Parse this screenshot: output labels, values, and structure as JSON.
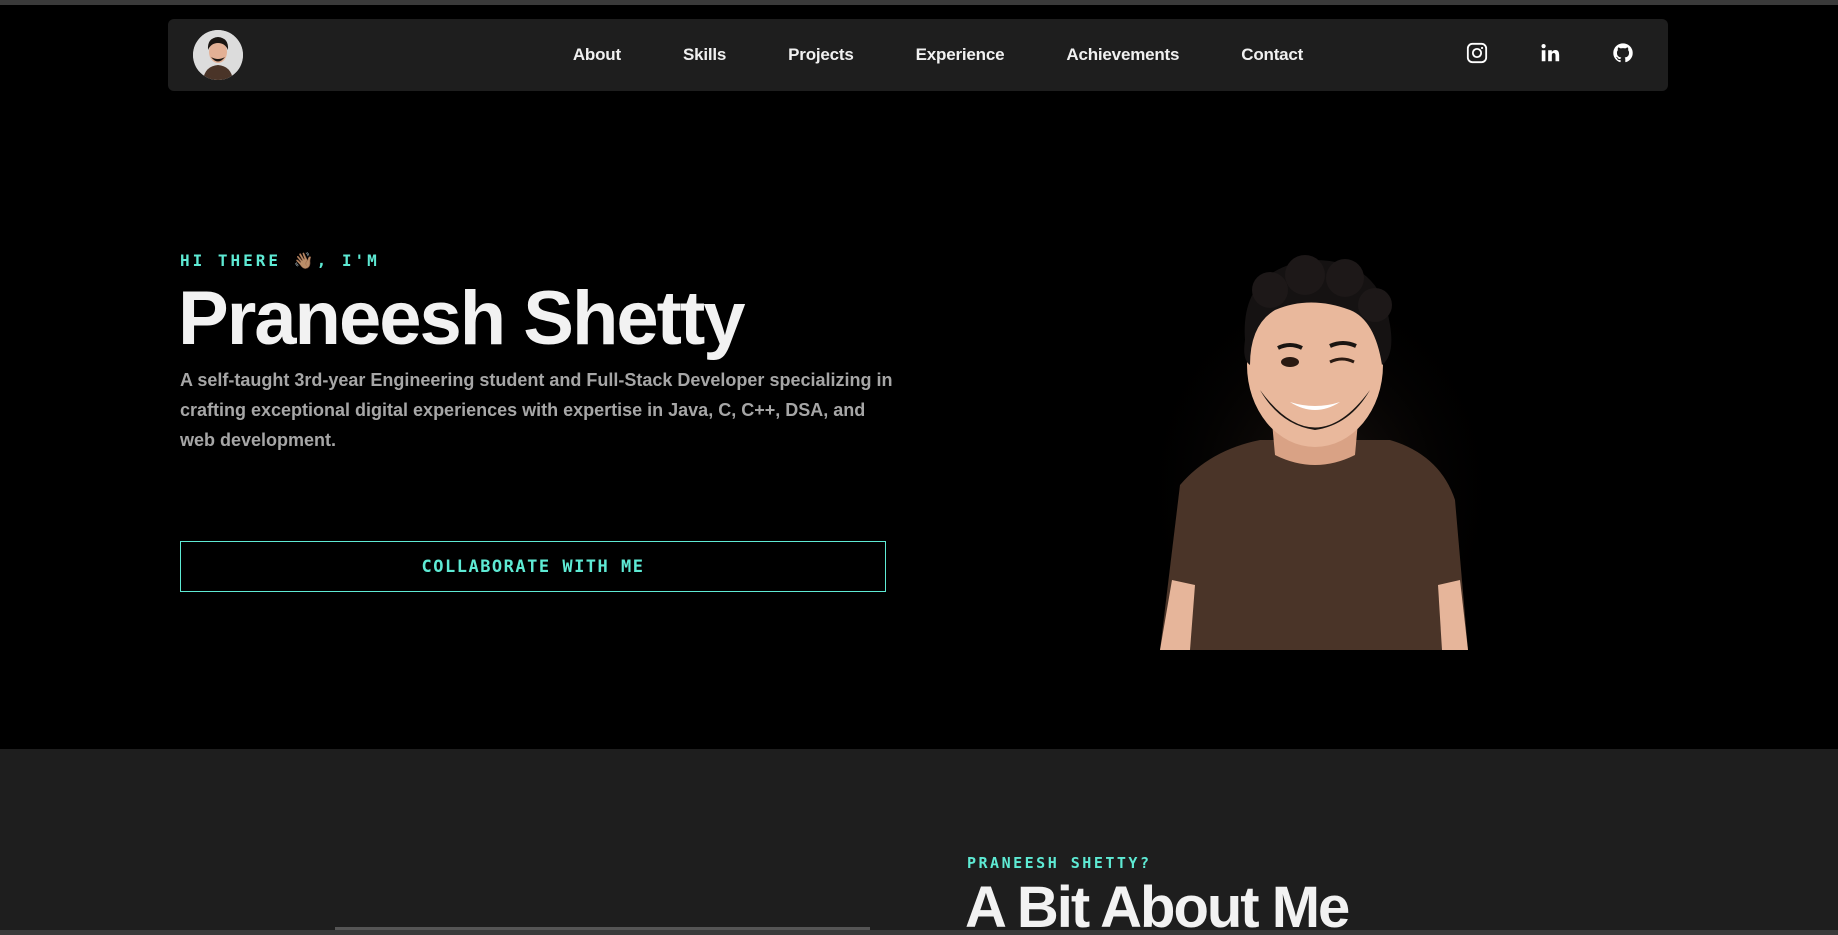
{
  "nav": {
    "links": [
      {
        "label": "About"
      },
      {
        "label": "Skills"
      },
      {
        "label": "Projects"
      },
      {
        "label": "Experience"
      },
      {
        "label": "Achievements"
      },
      {
        "label": "Contact"
      }
    ],
    "social": [
      "instagram-icon",
      "linkedin-icon",
      "github-icon"
    ]
  },
  "hero": {
    "greeting": "HI THERE 👋🏽, I'M",
    "name": "Praneesh Shetty",
    "description": "A self-taught 3rd-year Engineering student and Full-Stack Developer specializing in crafting exceptional digital experiences with expertise in Java, C, C++, DSA, and web development.",
    "cta": "COLLABORATE WITH ME"
  },
  "about": {
    "kicker": "PRANEESH SHETTY?",
    "title": "A Bit About Me"
  },
  "colors": {
    "accent": "#5eead4",
    "background": "#000000",
    "panel": "#1e1e1e",
    "text": "#f2f2f2",
    "muted": "#a6a6a6"
  }
}
